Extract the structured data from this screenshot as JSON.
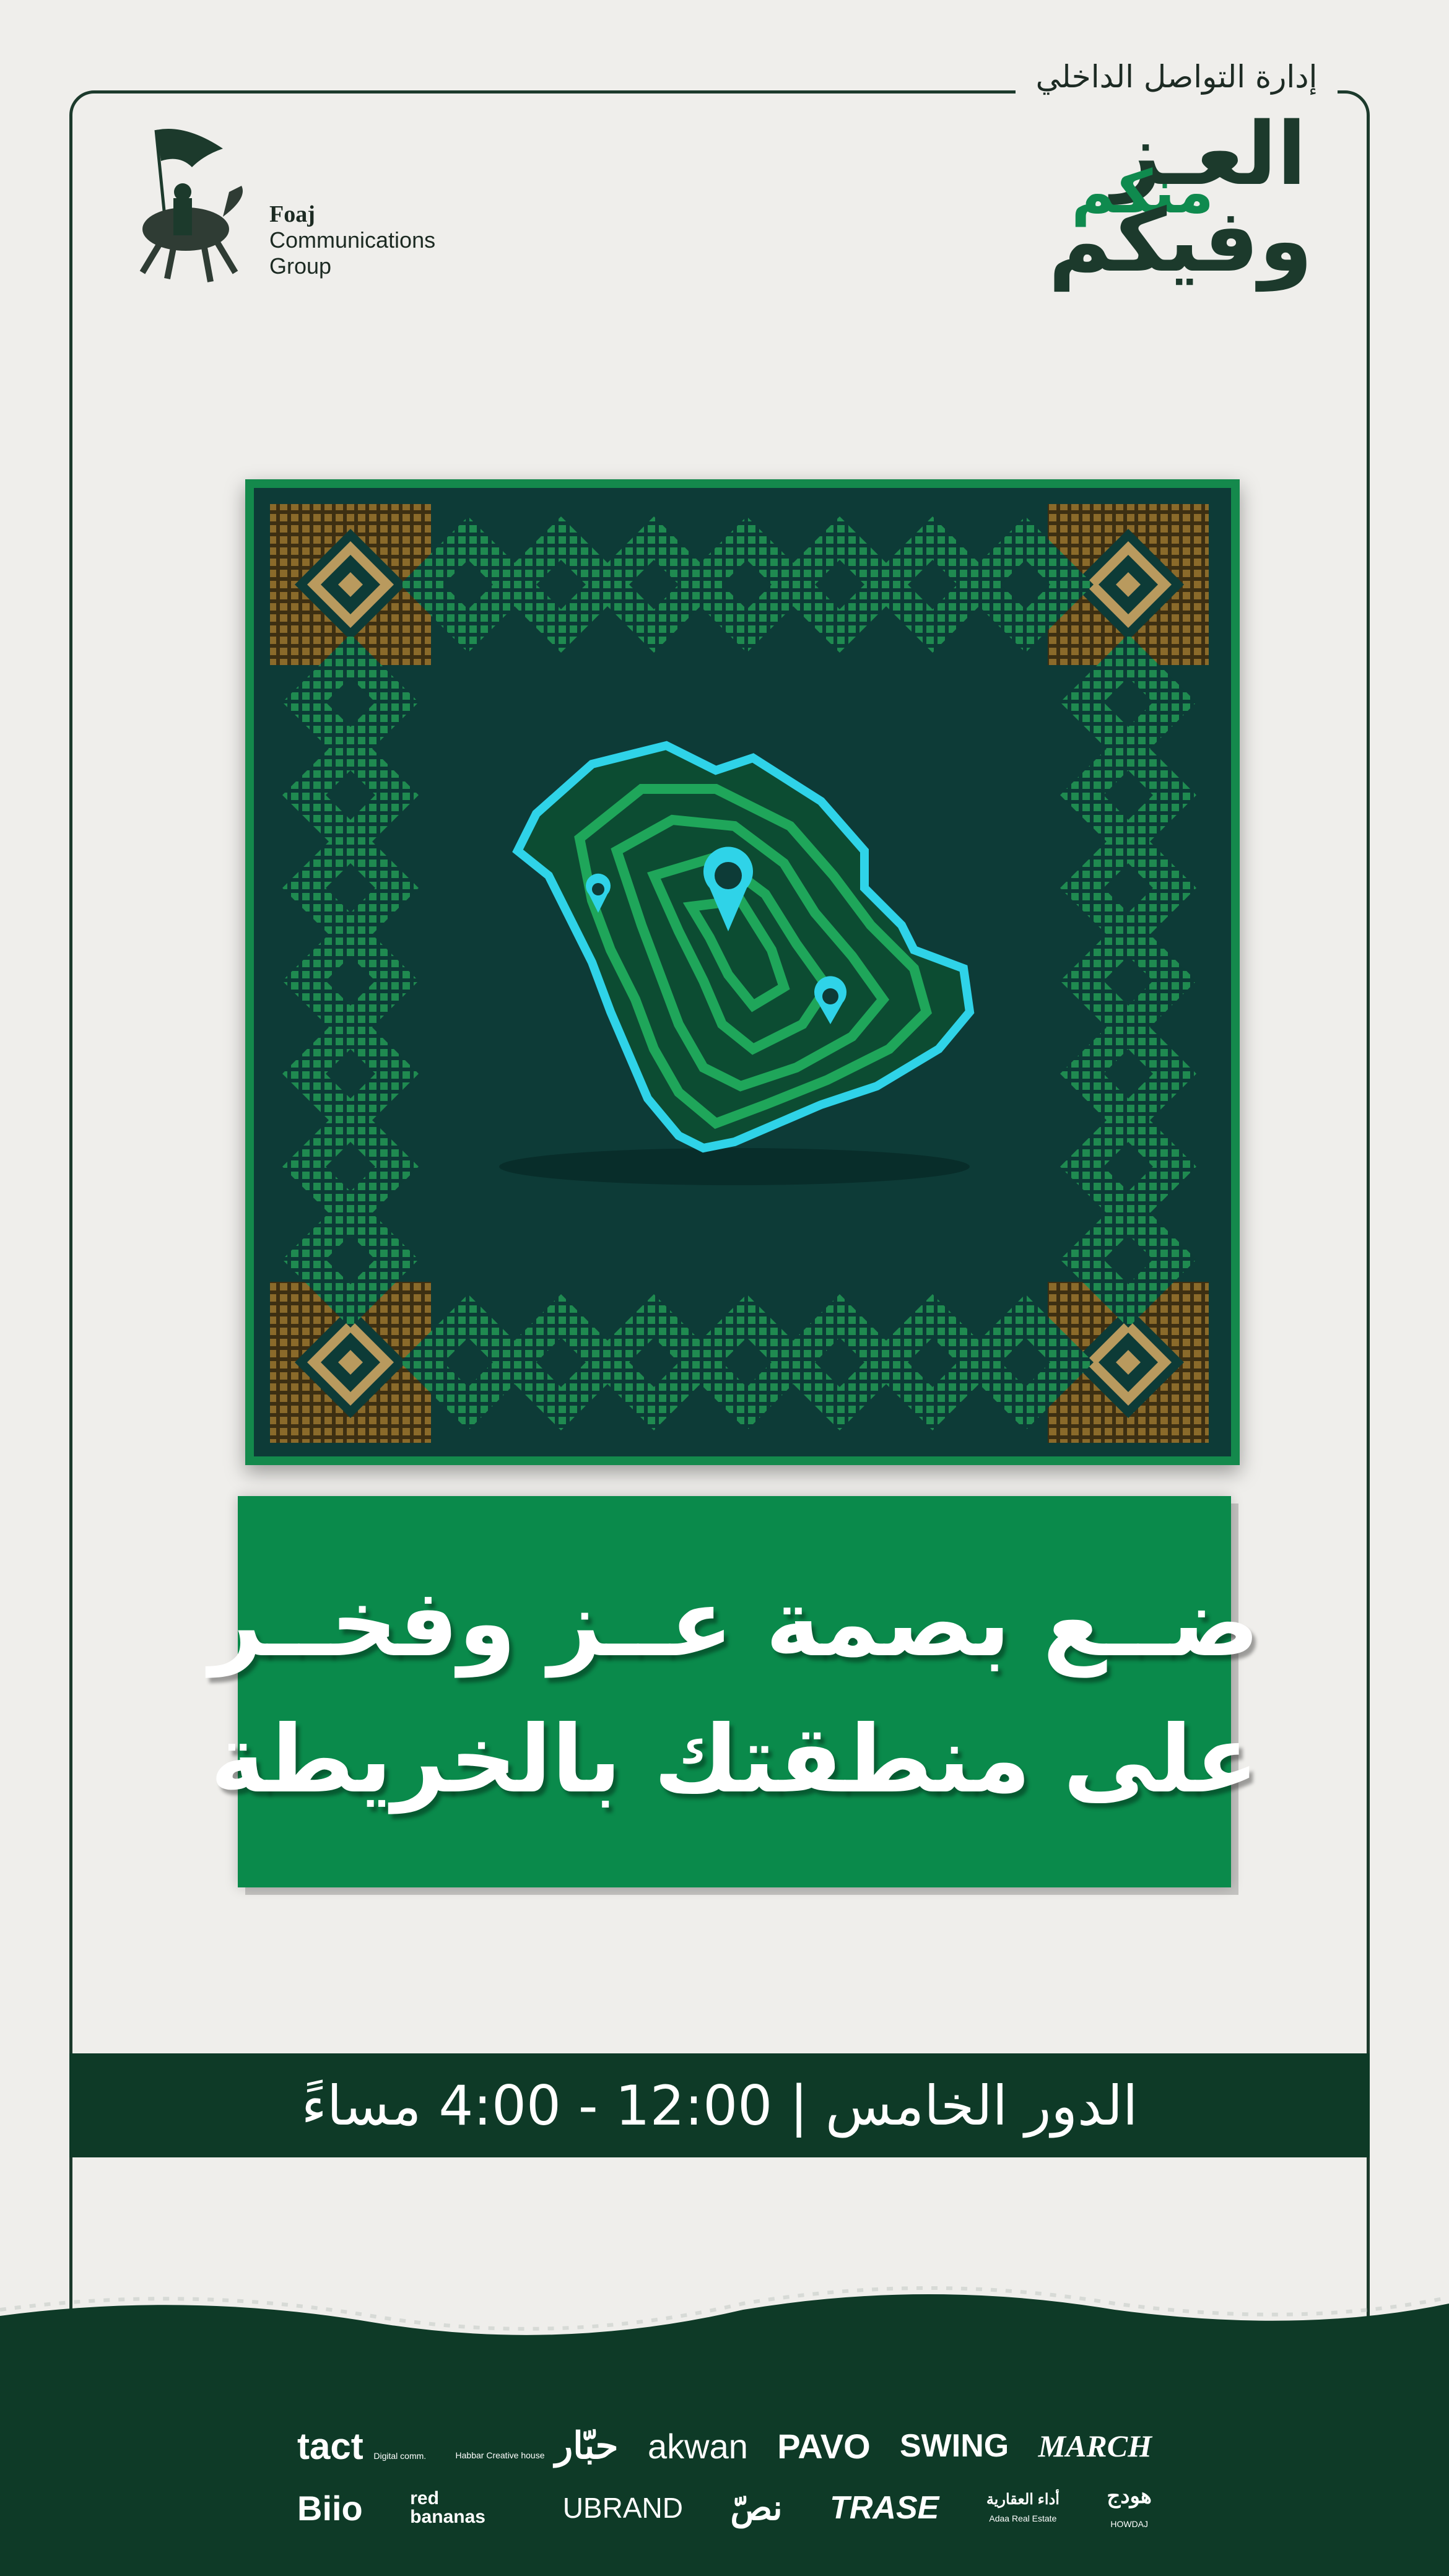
{
  "header": {
    "department": "إدارة التواصل الداخلي",
    "company_name": "Foaj",
    "company_line2": "Communications",
    "company_line3": "Group",
    "campaign_line1": "العـز",
    "campaign_line2": "منكم",
    "campaign_line3": "وفيكم"
  },
  "headline": {
    "line1": "ضــع بصمة عــز وفخــر",
    "line2": "على منطقتك بالخريطة"
  },
  "event": {
    "details": "الدور الخامس | 12:00 - 4:00 مساءً"
  },
  "sponsors": {
    "row1": [
      "tact",
      "حبّار",
      "akwan",
      "PAVO",
      "SWING",
      "MARCH"
    ],
    "row1_sub": {
      "tact": "Digital comm.",
      "habbar": "Habbar Creative house"
    },
    "row2": [
      "Biio",
      "red bananas",
      "UBRAND",
      "نصّ",
      "TRASE",
      "أداء العقارية",
      "هودج"
    ],
    "row2_sub": {
      "adaa": "Adaa Real Estate",
      "howdaj": "HOWDAJ"
    }
  },
  "colors": {
    "background": "#efeeeb",
    "dark_green": "#0e3a27",
    "brand_green": "#0a8a4b",
    "map_cyan": "#2fd3e8"
  }
}
